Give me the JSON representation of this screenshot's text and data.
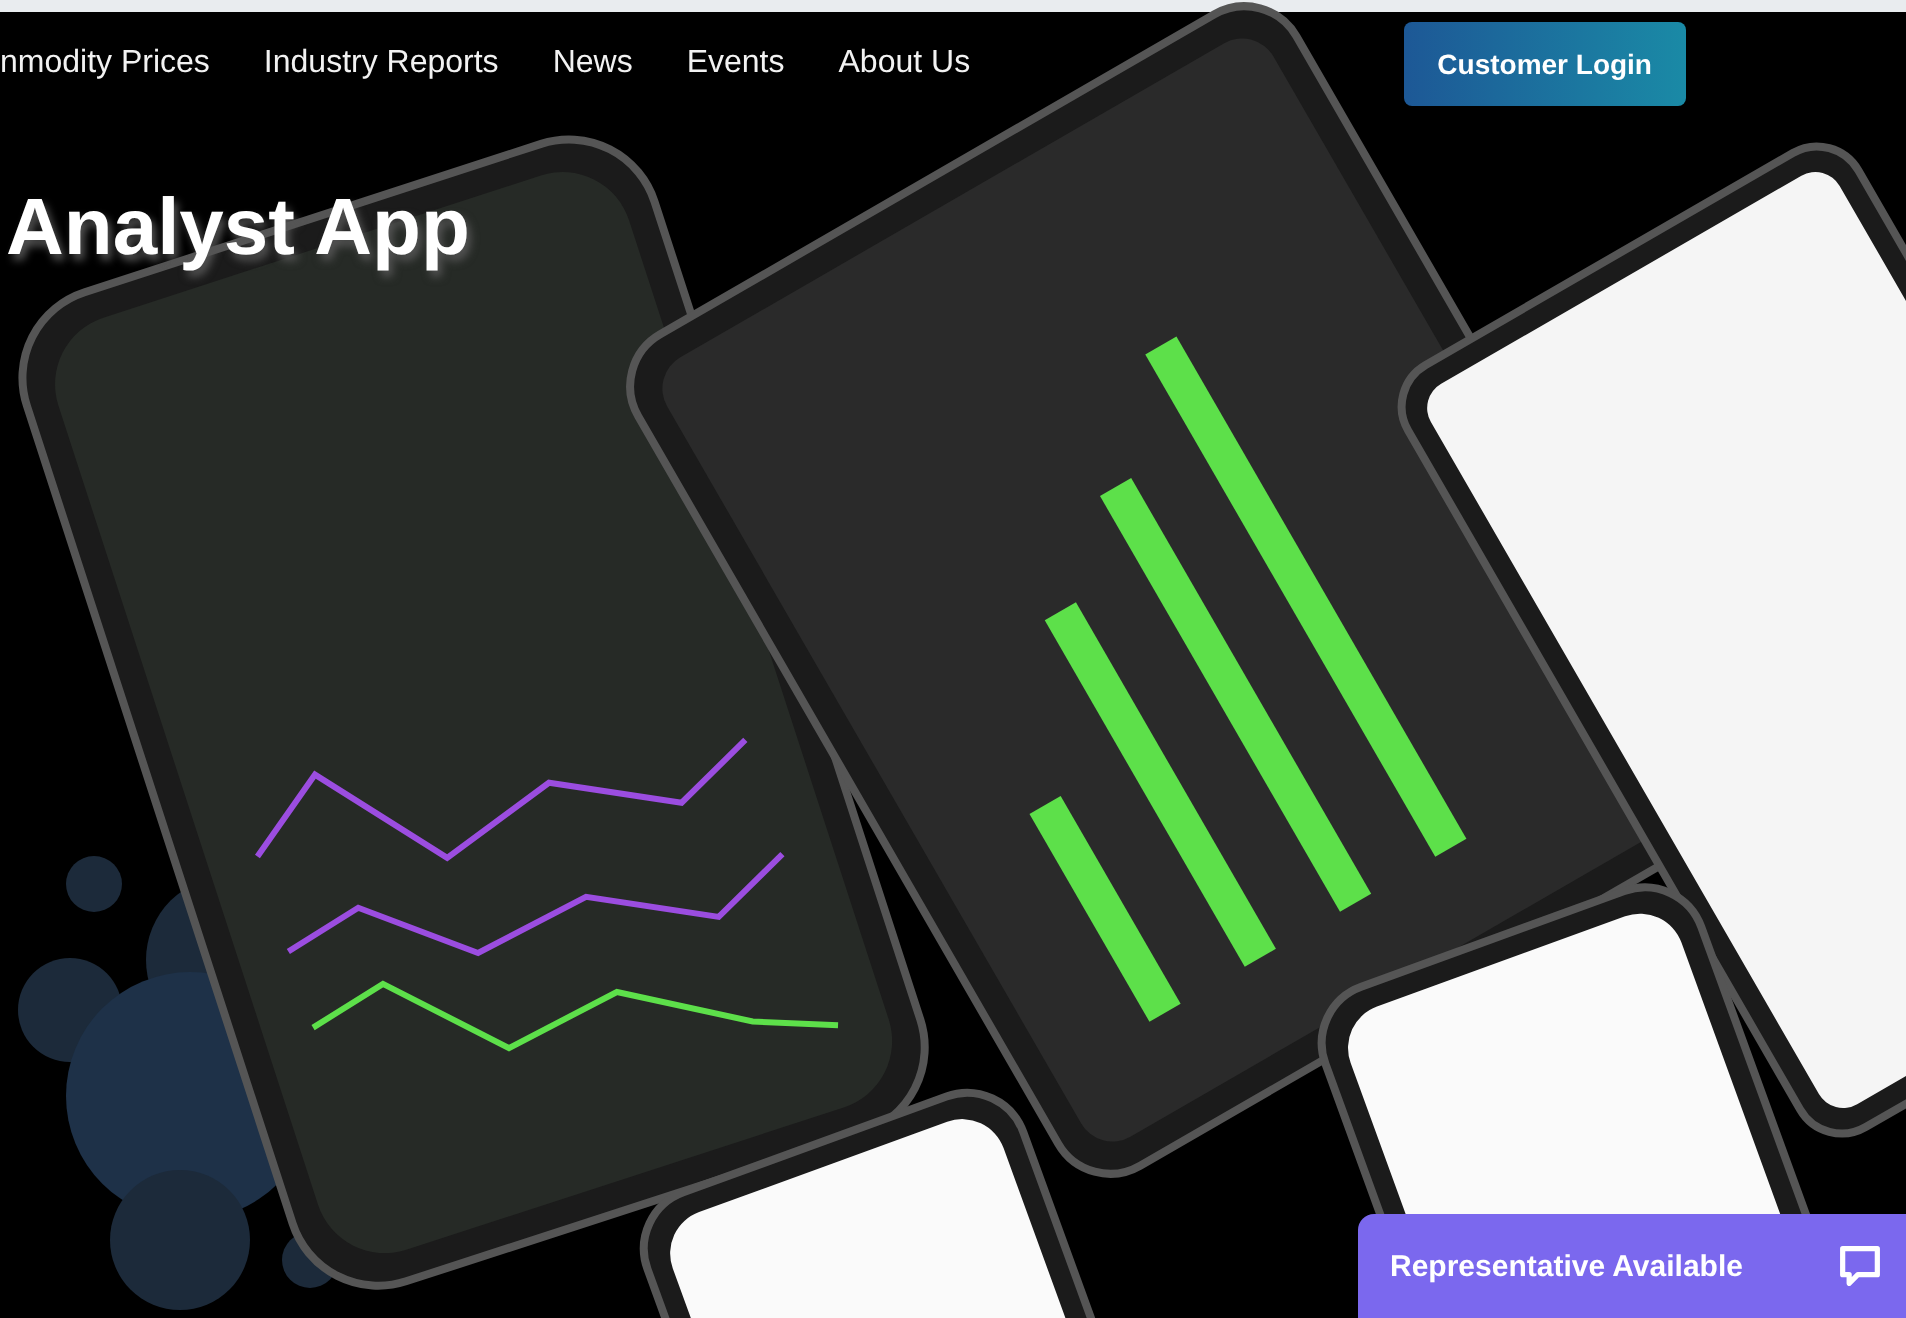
{
  "nav": {
    "links": [
      {
        "label": "nmodity Prices"
      },
      {
        "label": "Industry Reports"
      },
      {
        "label": "News"
      },
      {
        "label": "Events"
      },
      {
        "label": "About Us"
      }
    ],
    "login_button": "Customer Login"
  },
  "hero": {
    "title": "Analyst App"
  },
  "chat_widget": {
    "label": "Representative Available"
  }
}
